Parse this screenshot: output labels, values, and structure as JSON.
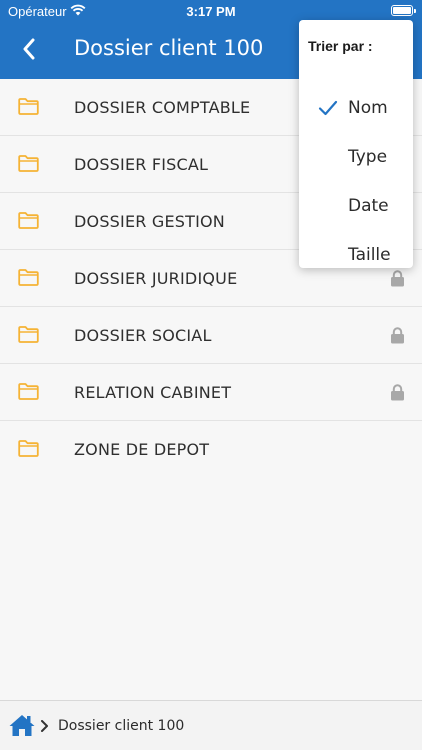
{
  "status_bar": {
    "carrier": "Opérateur",
    "time": "3:17 PM"
  },
  "header": {
    "title": "Dossier client 100",
    "back_icon": "chevron-left-icon",
    "background_color": "#2374c4"
  },
  "folders": [
    {
      "label": "DOSSIER COMPTABLE",
      "locked": false
    },
    {
      "label": "DOSSIER FISCAL",
      "locked": false
    },
    {
      "label": "DOSSIER GESTION",
      "locked": false
    },
    {
      "label": "DOSSIER JURIDIQUE",
      "locked": true
    },
    {
      "label": "DOSSIER SOCIAL",
      "locked": true
    },
    {
      "label": "RELATION CABINET",
      "locked": true
    },
    {
      "label": "ZONE DE DEPOT",
      "locked": false
    }
  ],
  "folder_icon_color": "#f5b335",
  "lock_icon_color": "#a8a8a8",
  "sort_menu": {
    "title": "Trier par :",
    "options": [
      {
        "label": "Nom",
        "selected": true
      },
      {
        "label": "Type",
        "selected": false
      },
      {
        "label": "Date",
        "selected": false
      },
      {
        "label": "Taille",
        "selected": false
      }
    ],
    "check_color": "#2374c4"
  },
  "breadcrumb": {
    "home_icon": "home-icon",
    "separator_icon": "chevron-right-icon",
    "current": "Dossier client 100"
  }
}
